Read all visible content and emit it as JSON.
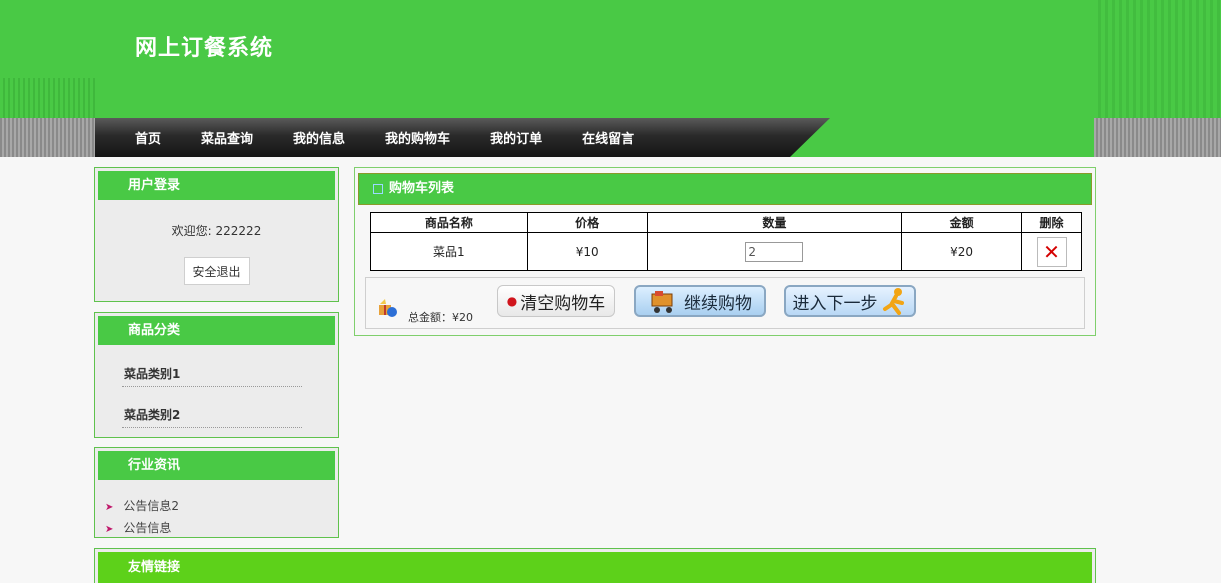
{
  "header": {
    "title": "网上订餐系统"
  },
  "nav": {
    "items": [
      "首页",
      "菜品查询",
      "我的信息",
      "我的购物车",
      "我的订单",
      "在线留言"
    ]
  },
  "login_box": {
    "title": "用户登录",
    "welcome": "欢迎您: 222222",
    "logout_label": "安全退出"
  },
  "category_box": {
    "title": "商品分类",
    "items": [
      "菜品类别1",
      "菜品类别2"
    ]
  },
  "news_box": {
    "title": "行业资讯",
    "items": [
      "公告信息2",
      "公告信息"
    ]
  },
  "cart": {
    "title": "购物车列表",
    "columns": [
      "商品名称",
      "价格",
      "数量",
      "金额",
      "删除"
    ],
    "rows": [
      {
        "name": "菜品1",
        "price": "¥10",
        "quantity": "2",
        "amount": "¥20"
      }
    ],
    "total_label": "总金额：¥20",
    "clear_label": "清空购物车",
    "continue_label": "继续购物",
    "next_label": "进入下一步"
  },
  "links_box": {
    "title": "友情链接"
  },
  "colors": {
    "brand_green": "#49c945",
    "nav_dark": "#1e1e1e",
    "delete_red": "#d40000"
  }
}
